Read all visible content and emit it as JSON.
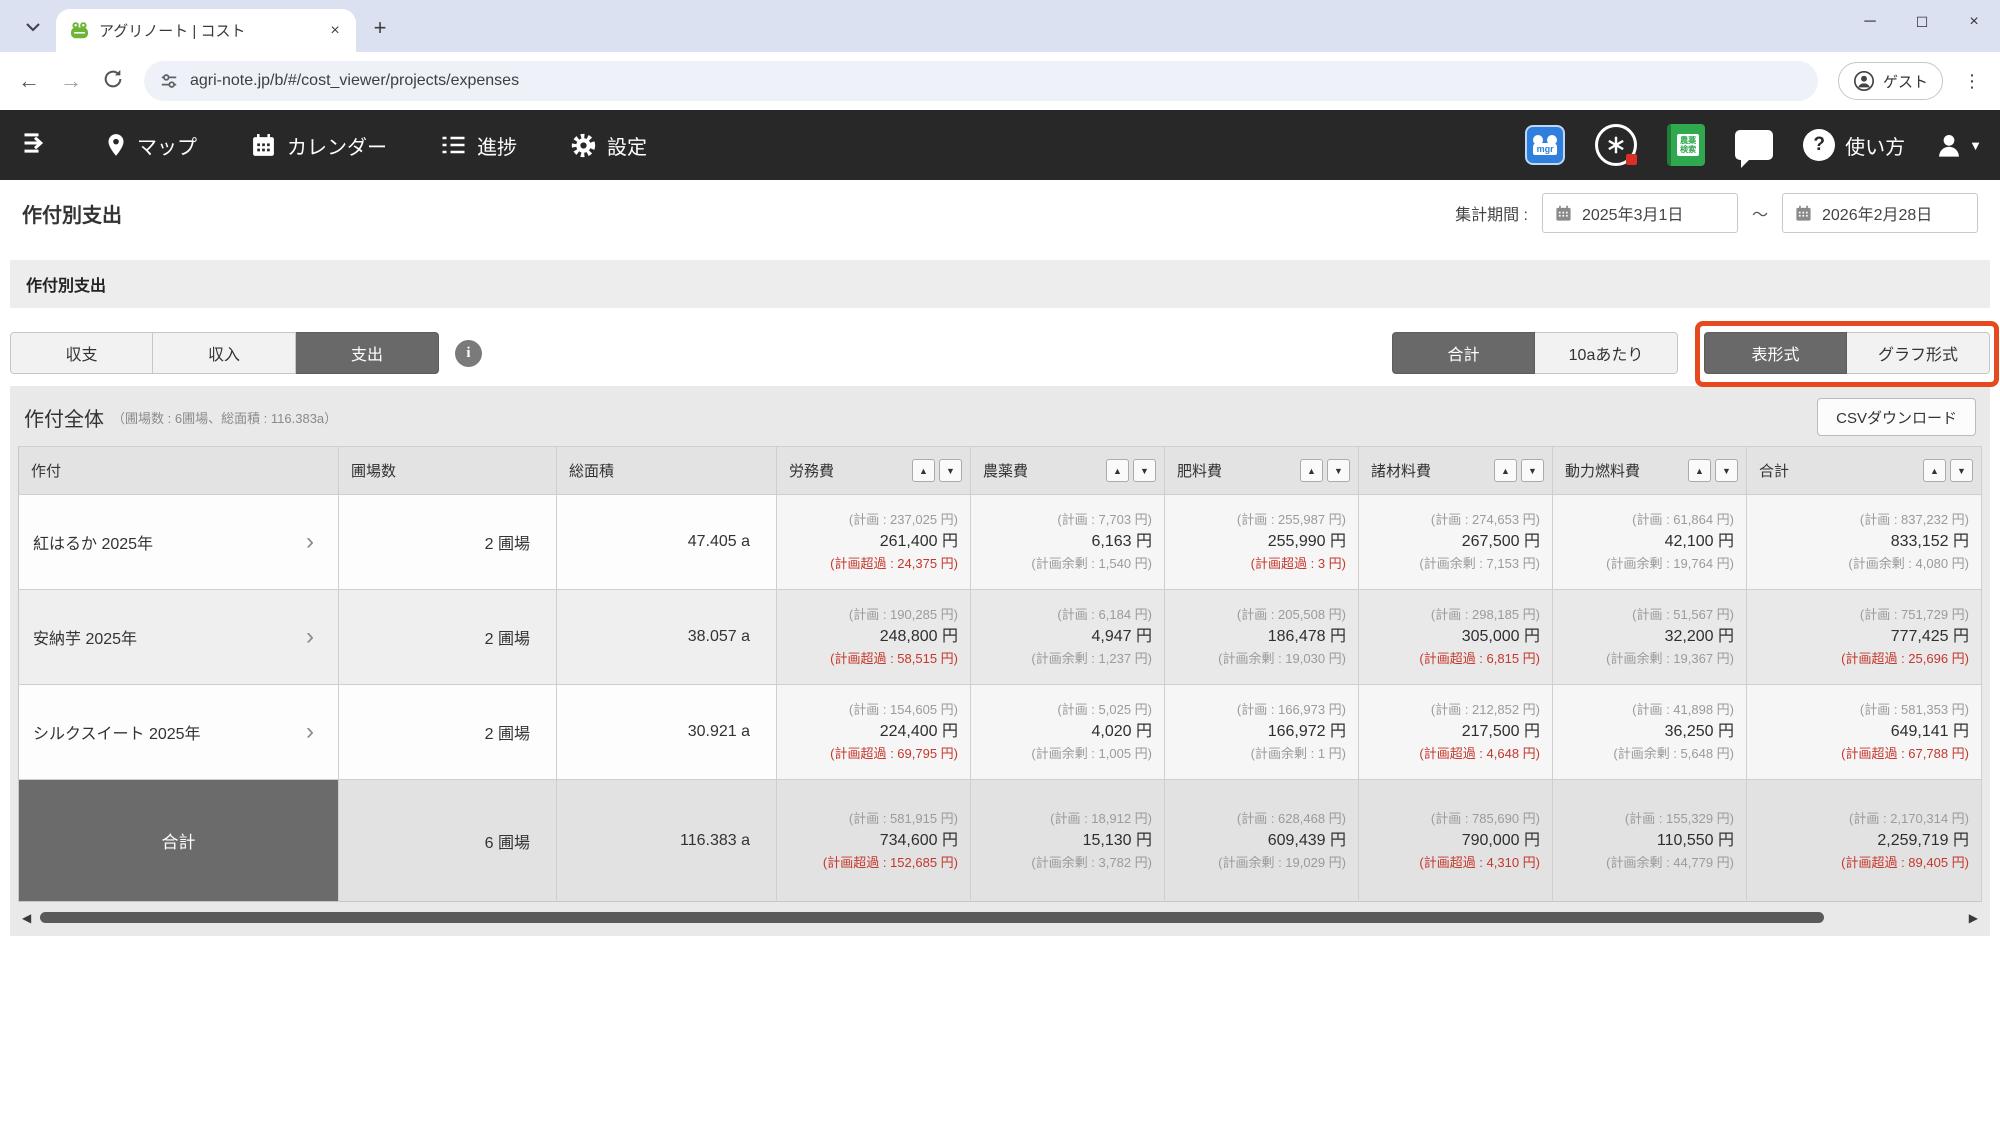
{
  "browser": {
    "tab_title": "アグリノート | コスト",
    "url": "agri-note.jp/b/#/cost_viewer/projects/expenses",
    "guest_label": "ゲスト"
  },
  "nav": {
    "items": [
      {
        "label": "マップ"
      },
      {
        "label": "カレンダー"
      },
      {
        "label": "進捗"
      },
      {
        "label": "設定"
      }
    ],
    "mgr_text": "mgr",
    "book_lines": [
      "農薬",
      "検索"
    ],
    "help_label": "使い方"
  },
  "header": {
    "title": "作付別支出",
    "period_label": "集計期間 :",
    "period_from": "2025年3月1日",
    "period_separator": "〜",
    "period_to": "2026年2月28日"
  },
  "section": {
    "title": "作付別支出"
  },
  "toggles": {
    "mode": {
      "options": [
        "収支",
        "収入",
        "支出"
      ],
      "selected": 2
    },
    "unit": {
      "options": [
        "合計",
        "10aあたり"
      ],
      "selected": 0
    },
    "view": {
      "options": [
        "表形式",
        "グラフ形式"
      ],
      "selected": 0
    }
  },
  "summary": {
    "title": "作付全体",
    "subtitle": "（圃場数 : 6圃場、総面積 : 116.383a）",
    "csv_label": "CSVダウンロード"
  },
  "table": {
    "columns": [
      {
        "label": "作付",
        "sortable": false
      },
      {
        "label": "圃場数",
        "sortable": false
      },
      {
        "label": "総面積",
        "sortable": false
      },
      {
        "label": "労務費",
        "sortable": true
      },
      {
        "label": "農薬費",
        "sortable": true
      },
      {
        "label": "肥料費",
        "sortable": true
      },
      {
        "label": "諸材料費",
        "sortable": true
      },
      {
        "label": "動力燃料費",
        "sortable": true
      },
      {
        "label": "合計",
        "sortable": true
      }
    ],
    "rows": [
      {
        "name": "紅はるか 2025年",
        "fields": "2 圃場",
        "area": "47.405 a",
        "costs": [
          {
            "plan": "(計画 : 237,025 円)",
            "actual": "261,400 円",
            "diff": "(計画超過 : 24,375 円)",
            "over": true
          },
          {
            "plan": "(計画 : 7,703 円)",
            "actual": "6,163 円",
            "diff": "(計画余剰 : 1,540 円)",
            "over": false
          },
          {
            "plan": "(計画 : 255,987 円)",
            "actual": "255,990 円",
            "diff": "(計画超過 : 3 円)",
            "over": true
          },
          {
            "plan": "(計画 : 274,653 円)",
            "actual": "267,500 円",
            "diff": "(計画余剰 : 7,153 円)",
            "over": false
          },
          {
            "plan": "(計画 : 61,864 円)",
            "actual": "42,100 円",
            "diff": "(計画余剰 : 19,764 円)",
            "over": false
          },
          {
            "plan": "(計画 : 837,232 円)",
            "actual": "833,152 円",
            "diff": "(計画余剰 : 4,080 円)",
            "over": false
          }
        ]
      },
      {
        "name": "安納芋 2025年",
        "fields": "2 圃場",
        "area": "38.057 a",
        "costs": [
          {
            "plan": "(計画 : 190,285 円)",
            "actual": "248,800 円",
            "diff": "(計画超過 : 58,515 円)",
            "over": true
          },
          {
            "plan": "(計画 : 6,184 円)",
            "actual": "4,947 円",
            "diff": "(計画余剰 : 1,237 円)",
            "over": false
          },
          {
            "plan": "(計画 : 205,508 円)",
            "actual": "186,478 円",
            "diff": "(計画余剰 : 19,030 円)",
            "over": false
          },
          {
            "plan": "(計画 : 298,185 円)",
            "actual": "305,000 円",
            "diff": "(計画超過 : 6,815 円)",
            "over": true
          },
          {
            "plan": "(計画 : 51,567 円)",
            "actual": "32,200 円",
            "diff": "(計画余剰 : 19,367 円)",
            "over": false
          },
          {
            "plan": "(計画 : 751,729 円)",
            "actual": "777,425 円",
            "diff": "(計画超過 : 25,696 円)",
            "over": true
          }
        ]
      },
      {
        "name": "シルクスイート 2025年",
        "fields": "2 圃場",
        "area": "30.921 a",
        "costs": [
          {
            "plan": "(計画 : 154,605 円)",
            "actual": "224,400 円",
            "diff": "(計画超過 : 69,795 円)",
            "over": true
          },
          {
            "plan": "(計画 : 5,025 円)",
            "actual": "4,020 円",
            "diff": "(計画余剰 : 1,005 円)",
            "over": false
          },
          {
            "plan": "(計画 : 166,973 円)",
            "actual": "166,972 円",
            "diff": "(計画余剰 : 1 円)",
            "over": false
          },
          {
            "plan": "(計画 : 212,852 円)",
            "actual": "217,500 円",
            "diff": "(計画超過 : 4,648 円)",
            "over": true
          },
          {
            "plan": "(計画 : 41,898 円)",
            "actual": "36,250 円",
            "diff": "(計画余剰 : 5,648 円)",
            "over": false
          },
          {
            "plan": "(計画 : 581,353 円)",
            "actual": "649,141 円",
            "diff": "(計画超過 : 67,788 円)",
            "over": true
          }
        ]
      }
    ],
    "total": {
      "name": "合計",
      "fields": "6 圃場",
      "area": "116.383 a",
      "costs": [
        {
          "plan": "(計画 : 581,915 円)",
          "actual": "734,600 円",
          "diff": "(計画超過 : 152,685 円)",
          "over": true
        },
        {
          "plan": "(計画 : 18,912 円)",
          "actual": "15,130 円",
          "diff": "(計画余剰 : 3,782 円)",
          "over": false
        },
        {
          "plan": "(計画 : 628,468 円)",
          "actual": "609,439 円",
          "diff": "(計画余剰 : 19,029 円)",
          "over": false
        },
        {
          "plan": "(計画 : 785,690 円)",
          "actual": "790,000 円",
          "diff": "(計画超過 : 4,310 円)",
          "over": true
        },
        {
          "plan": "(計画 : 155,329 円)",
          "actual": "110,550 円",
          "diff": "(計画余剰 : 44,779 円)",
          "over": false
        },
        {
          "plan": "(計画 : 2,170,314 円)",
          "actual": "2,259,719 円",
          "diff": "(計画超過 : 89,405 円)",
          "over": true
        }
      ]
    }
  },
  "colors": {
    "accent_red": "#c4372c",
    "highlight_orange": "#e5491d",
    "nav_dark": "#282828",
    "selected_gray": "#696969"
  }
}
